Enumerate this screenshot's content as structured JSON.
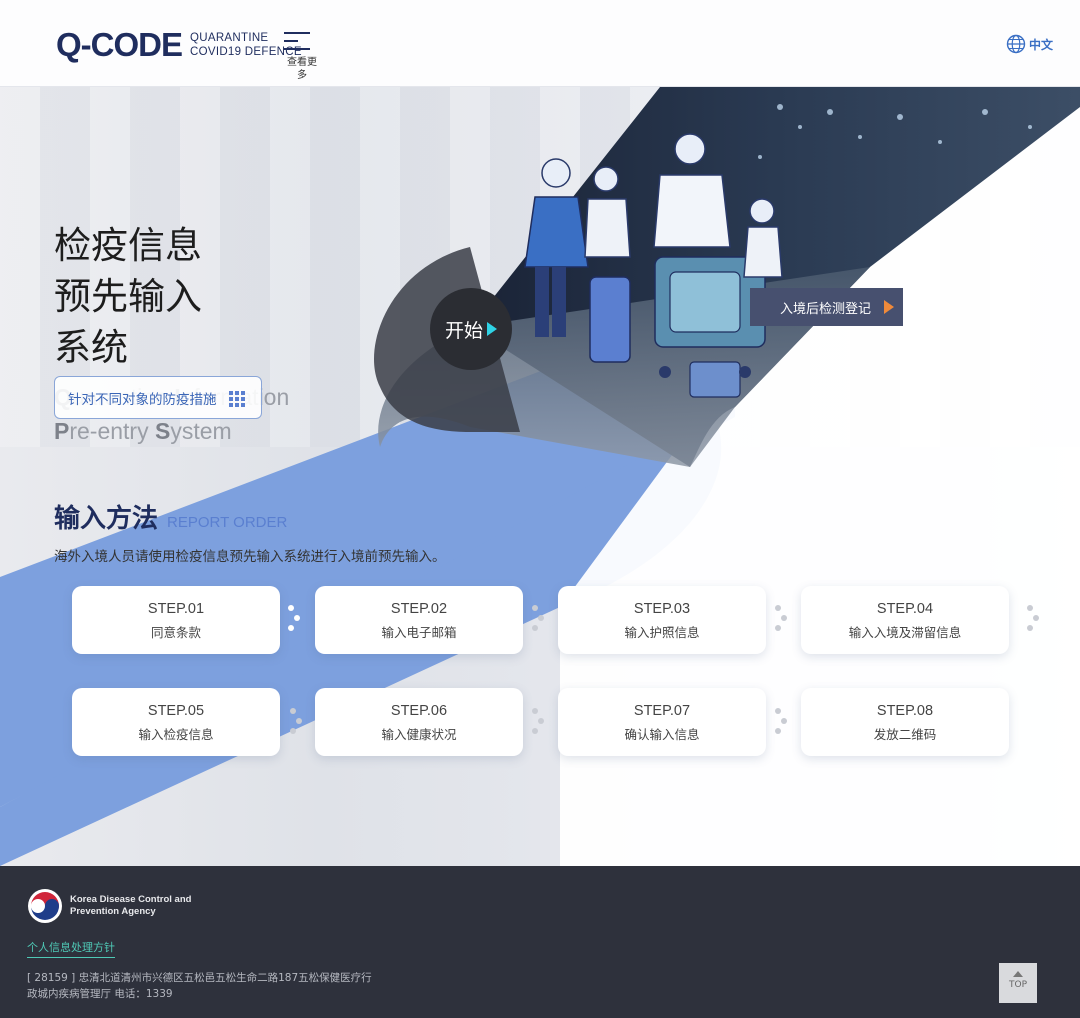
{
  "header": {
    "logo_text": "Q-CODE",
    "logo_sub_line1": "QUARANTINE",
    "logo_sub_line2": "COVID19 DEFENCE",
    "menu_label": "查看更多",
    "lang_label": "中文"
  },
  "hero": {
    "title_line1": "检疫信息",
    "title_line2": "预先输入",
    "title_line3": "系统",
    "subtitle_line1_cap1": "Q",
    "subtitle_line1_rest1": "uarantine ",
    "subtitle_line1_cap2": "I",
    "subtitle_line1_rest2": "nformation",
    "subtitle_line2_cap1": "P",
    "subtitle_line2_rest1": "re-entry ",
    "subtitle_line2_cap2": "S",
    "subtitle_line2_rest2": "ystem",
    "measures_button": "针对不同对象的防疫措施",
    "start_button": "开始",
    "post_entry_button": "入境后检测登记"
  },
  "steps": {
    "title": "输入方法",
    "title_en": "REPORT ORDER",
    "description": "海外入境人员请使用检疫信息预先输入系统进行入境前预先输入。",
    "items": [
      {
        "num": "STEP.01",
        "label": "同意条款"
      },
      {
        "num": "STEP.02",
        "label": "输入电子邮箱"
      },
      {
        "num": "STEP.03",
        "label": "输入护照信息"
      },
      {
        "num": "STEP.04",
        "label": "输入入境及滞留信息"
      },
      {
        "num": "STEP.05",
        "label": "输入检疫信息"
      },
      {
        "num": "STEP.06",
        "label": "输入健康状况"
      },
      {
        "num": "STEP.07",
        "label": "确认输入信息"
      },
      {
        "num": "STEP.08",
        "label": "发放二维码"
      }
    ]
  },
  "footer": {
    "agency_line1": "Korea Disease Control and",
    "agency_line2": "Prevention Agency",
    "privacy_link": "个人信息处理方针",
    "address_line1": "[ 28159 ] 忠清北道清州市兴德区五松邑五松生命二路187五松保健医疗行",
    "address_line2": "政城内疾病管理厅 电话：1339",
    "top_button": "TOP"
  },
  "colors": {
    "brand_navy": "#1f2d5e",
    "accent_blue": "#7da0de",
    "footer_bg": "#2e313c",
    "privacy_green": "#4fc9b6",
    "start_arrow": "#2fd3e6",
    "post_arrow": "#f08a3a"
  },
  "icons": [
    "globe-icon",
    "menu-icon",
    "grid-icon",
    "play-icon",
    "kdca-logo-icon",
    "arrow-up-icon"
  ]
}
